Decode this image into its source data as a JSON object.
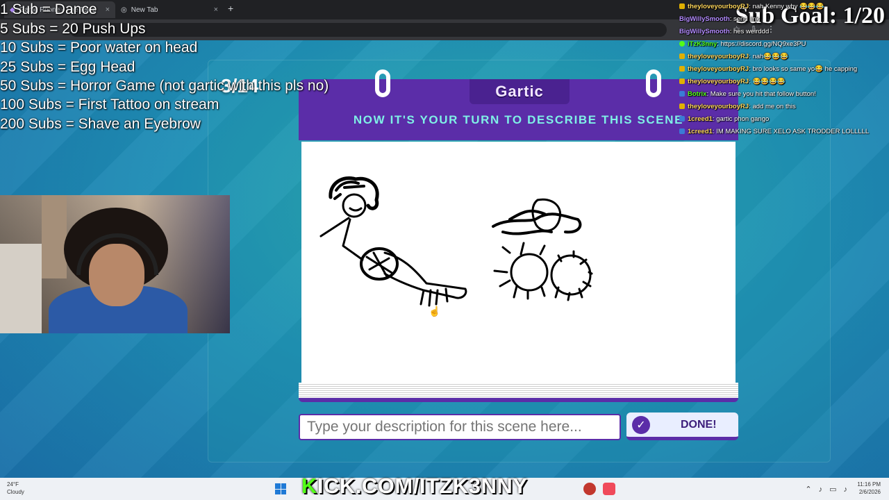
{
  "browser": {
    "tabs": [
      {
        "label": "Gartic Phone - The Telephone Game",
        "active": true
      },
      {
        "label": "New Tab",
        "active": false
      }
    ],
    "new_tab_symbol": "+",
    "close_symbol": "×"
  },
  "overlay": {
    "goals": [
      "1 Sub = Dance",
      "5 Subs = 20 Push Ups",
      "10 Subs =  Poor water on head",
      "25 Subs = Egg Head",
      "50 Subs =  Horror Game (not gartic with this pls no)",
      "100 Subs = First Tattoo on stream",
      "200 Subs =  Shave an Eyebrow"
    ],
    "sub_goal": "Sub Goal: 1/20",
    "kick_prefix": "K",
    "kick_rest": "ICK.COM/ITZK3NNY"
  },
  "game": {
    "round": "3/14",
    "logo": "Gartic",
    "prompt": "NOW IT'S YOUR TURN TO DESCRIBE THIS SCENE",
    "input_placeholder": "Type your description for this scene here...",
    "done_label": "DONE!",
    "accent": "#5b2da8",
    "prompt_color": "#7ff0e6"
  },
  "chat": [
    {
      "user": "theyloveyourboyRJ",
      "text": ": nah Kenny why 😂😂😂",
      "color": "#ffd65b"
    },
    {
      "user": "BigWillySmooth",
      "text": ": send link",
      "color": "#b38bff"
    },
    {
      "user": "BigWillySmooth",
      "text": ": hes weirddd",
      "color": "#b38bff"
    },
    {
      "user": "iTzK3nny",
      "text": ": https://discord.gg/NQ9xe3PU",
      "color": "#53fc18"
    },
    {
      "user": "theyloveyourboyRJ",
      "text": ": nah😂😂😂",
      "color": "#ffd65b"
    },
    {
      "user": "theyloveyourboyRJ",
      "text": ": bro looks so same yo😂 he capping",
      "color": "#ffd65b"
    },
    {
      "user": "theyloveyourboyRJ",
      "text": ": 😂😂😂😂",
      "color": "#ffd65b"
    },
    {
      "user": "Botrix",
      "text": ": Make sure you hit that follow button!",
      "color": "#53fc18"
    },
    {
      "user": "theyloveyourboyRJ",
      "text": ": add me on this",
      "color": "#ffd65b"
    },
    {
      "user": "1creed1",
      "text": ": gartic phon gango",
      "color": "#ffd65b"
    },
    {
      "user": "1creed1",
      "text": ": IM MAKING SURE XELO ASK TRODDER LOLLLLL",
      "color": "#ffd65b"
    }
  ],
  "taskbar": {
    "weather_temp": "24°F",
    "weather_desc": "Cloudy",
    "time": "11:16 PM",
    "date": "2/6/2026"
  }
}
